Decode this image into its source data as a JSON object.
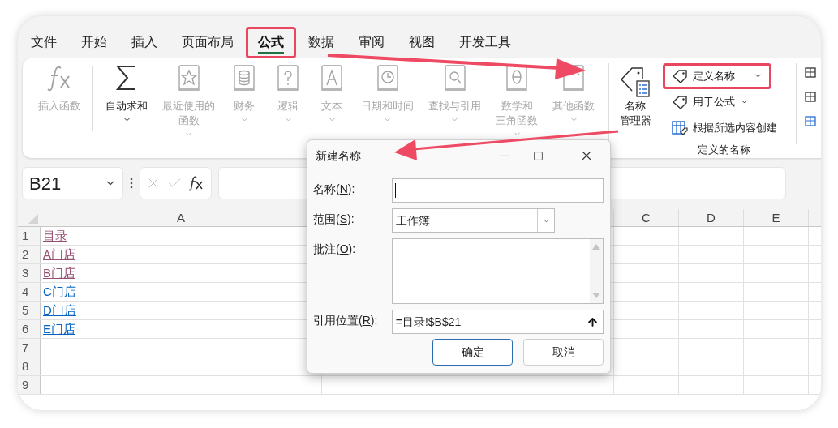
{
  "tabs": [
    {
      "label": "文件",
      "selected": false,
      "highlighted": false
    },
    {
      "label": "开始",
      "selected": false,
      "highlighted": false
    },
    {
      "label": "插入",
      "selected": false,
      "highlighted": false
    },
    {
      "label": "页面布局",
      "selected": false,
      "highlighted": false
    },
    {
      "label": "公式",
      "selected": true,
      "highlighted": true
    },
    {
      "label": "数据",
      "selected": false,
      "highlighted": false
    },
    {
      "label": "审阅",
      "selected": false,
      "highlighted": false
    },
    {
      "label": "视图",
      "selected": false,
      "highlighted": false
    },
    {
      "label": "开发工具",
      "selected": false,
      "highlighted": false
    }
  ],
  "ribbon": {
    "functions": [
      {
        "lines": [
          "插入函数"
        ],
        "caret": false,
        "disabled": true
      },
      {
        "lines": [
          "自动求和"
        ],
        "caret": true,
        "disabled": false
      },
      {
        "lines": [
          "最近使用的",
          "函数"
        ],
        "caret": true,
        "disabled": true
      },
      {
        "lines": [
          "财务"
        ],
        "caret": true,
        "disabled": true
      },
      {
        "lines": [
          "逻辑"
        ],
        "caret": true,
        "disabled": true
      },
      {
        "lines": [
          "文本"
        ],
        "caret": true,
        "disabled": true
      },
      {
        "lines": [
          "日期和时间"
        ],
        "caret": true,
        "disabled": true
      },
      {
        "lines": [
          "查找与引用"
        ],
        "caret": true,
        "disabled": true
      },
      {
        "lines": [
          "数学和",
          "三角函数"
        ],
        "caret": true,
        "disabled": true
      },
      {
        "lines": [
          "其他函数"
        ],
        "caret": true,
        "disabled": true
      }
    ],
    "name_manager": {
      "lines": [
        "名称",
        "管理器"
      ]
    },
    "name_commands": [
      {
        "label": "定义名称",
        "caret": true,
        "highlighted": true
      },
      {
        "label": "用于公式",
        "caret": true,
        "highlighted": false
      },
      {
        "label": "根据所选内容创建",
        "caret": false,
        "highlighted": false
      }
    ],
    "group_label": "定义的名称"
  },
  "formula_bar": {
    "name_box": "B21"
  },
  "grid": {
    "columns": [
      "A",
      "C",
      "D",
      "E"
    ],
    "rows": [
      {
        "number": "1",
        "cell": "目录",
        "visited": true
      },
      {
        "number": "2",
        "cell": "A门店",
        "visited": true
      },
      {
        "number": "3",
        "cell": "B门店",
        "visited": true
      },
      {
        "number": "4",
        "cell": "C门店",
        "visited": false
      },
      {
        "number": "5",
        "cell": "D门店",
        "visited": false
      },
      {
        "number": "6",
        "cell": "E门店",
        "visited": false
      },
      {
        "number": "7"
      },
      {
        "number": "8"
      },
      {
        "number": "9"
      }
    ]
  },
  "dialog": {
    "title": "新建名称",
    "fields": [
      {
        "kind": "text",
        "label": [
          "名称(",
          "N",
          "):"
        ]
      },
      {
        "kind": "select",
        "label": [
          "范围(",
          "S",
          "):"
        ],
        "value": "工作簿"
      },
      {
        "kind": "textarea",
        "label": [
          "批注(",
          "O",
          "):"
        ]
      },
      {
        "kind": "reference",
        "label": [
          "引用位置(",
          "R",
          "):"
        ],
        "value": "=目录!$B$21"
      }
    ],
    "buttons": [
      {
        "label": "确定",
        "selected": true
      },
      {
        "label": "取消",
        "selected": false
      }
    ]
  }
}
